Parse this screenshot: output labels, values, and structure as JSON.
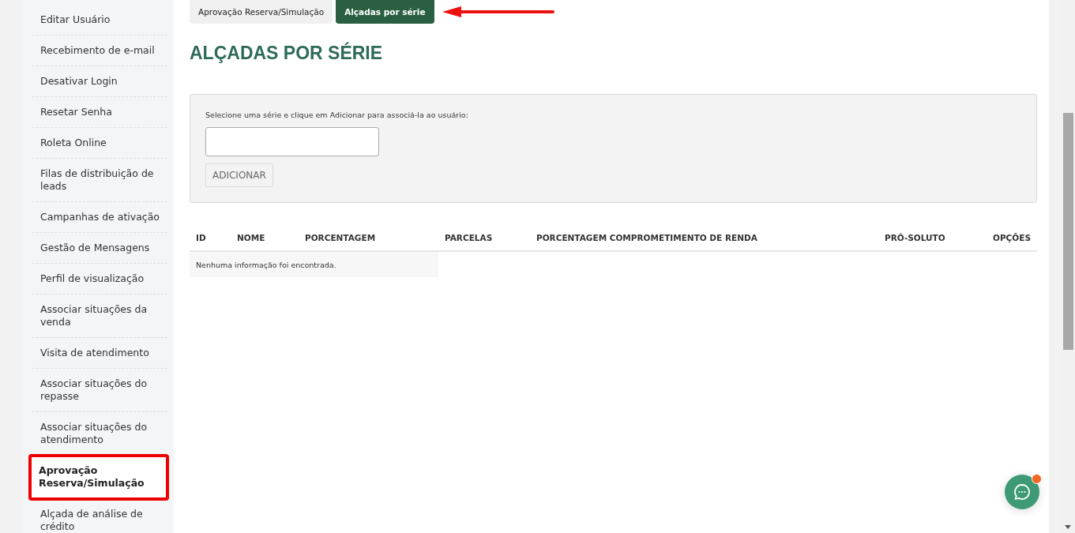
{
  "sidebar": {
    "items": [
      {
        "label": "Editar Usuário",
        "selected": false
      },
      {
        "label": "Recebimento de e-mail",
        "selected": false
      },
      {
        "label": "Desativar Login",
        "selected": false
      },
      {
        "label": "Resetar Senha",
        "selected": false
      },
      {
        "label": "Roleta Online",
        "selected": false
      },
      {
        "label": "Filas de distribuição de leads",
        "selected": false
      },
      {
        "label": "Campanhas de ativação",
        "selected": false
      },
      {
        "label": "Gestão de Mensagens",
        "selected": false
      },
      {
        "label": "Perfil de visualização",
        "selected": false
      },
      {
        "label": "Associar situações da venda",
        "selected": false
      },
      {
        "label": "Visita de atendimento",
        "selected": false
      },
      {
        "label": "Associar situações do repasse",
        "selected": false
      },
      {
        "label": "Associar situações do atendimento",
        "selected": false
      },
      {
        "label": "Aprovação Reserva/Simulação",
        "selected": true
      },
      {
        "label": "Alçada de análise de crédito",
        "selected": false
      }
    ]
  },
  "tabs": [
    {
      "label": "Aprovação Reserva/Simulação",
      "selected": false
    },
    {
      "label": "Alçadas por série",
      "selected": true
    }
  ],
  "heading": "ALÇADAS POR SÉRIE",
  "form": {
    "instruction": "Selecione uma série e clique em Adicionar para associá-la ao usuário:",
    "button": "ADICIONAR"
  },
  "table": {
    "columns": [
      "ID",
      "NOME",
      "PORCENTAGEM",
      "PARCELAS",
      "PORCENTAGEM COMPROMETIMENTO DE RENDA",
      "PRÓ-SOLUTO",
      "OPÇÕES"
    ],
    "empty_message": "Nenhuma informação foi encontrada."
  },
  "chat": {
    "unread": true
  }
}
